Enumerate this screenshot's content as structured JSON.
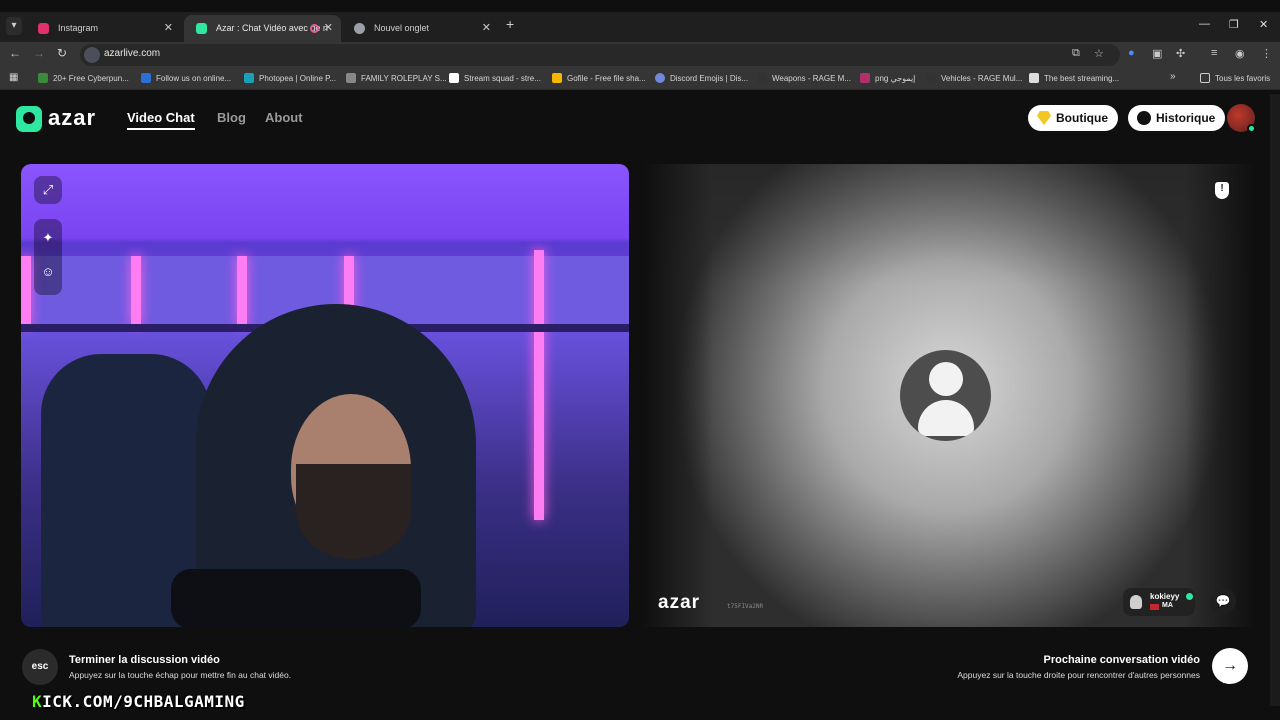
{
  "browser": {
    "tabs": [
      {
        "title": "Instagram",
        "icon": "instagram-icon",
        "color": "#e1306c",
        "active": false
      },
      {
        "title": "Azar : Chat Vidéo avec de n",
        "icon": "azar-icon",
        "color": "#2ee8a2",
        "active": true
      },
      {
        "title": "Nouvel onglet",
        "icon": "chrome-icon",
        "color": "#9aa0a6",
        "active": false
      }
    ],
    "url": "azarlive.com",
    "bookmarks": [
      {
        "label": "20+ Free Cyberpun...",
        "color": "#3d8a3a"
      },
      {
        "label": "Follow us on online...",
        "color": "#2a6fd6"
      },
      {
        "label": "Photopea | Online P...",
        "color": "#17a2b8"
      },
      {
        "label": "FAMILY ROLEPLAY S...",
        "color": "#888888"
      },
      {
        "label": "Stream squad - stre...",
        "color": "#ffffff"
      },
      {
        "label": "Gofile - Free file sha...",
        "color": "#f5b700"
      },
      {
        "label": "Discord Emojis | Dis...",
        "color": "#7289da"
      },
      {
        "label": "Weapons - RAGE M...",
        "color": "#333333"
      },
      {
        "label": "png إيموجي",
        "color": "#b0306a"
      },
      {
        "label": "Vehicles - RAGE Mul...",
        "color": "#333333"
      },
      {
        "label": "The best streaming...",
        "color": "#dddddd"
      }
    ],
    "all_bookmarks": "Tous les favoris"
  },
  "site": {
    "logo": "azar",
    "nav": [
      "Video Chat",
      "Blog",
      "About"
    ],
    "shop_label": "Boutique",
    "history_label": "Historique"
  },
  "partner": {
    "watermark": "azar",
    "watermark_id": "t75FIVa2NR",
    "username": "kokieyy",
    "country": "MA"
  },
  "footer": {
    "esc_label": "esc",
    "end_title": "Terminer la discussion vidéo",
    "end_sub": "Appuyez sur la touche échap pour mettre fin au chat vidéo.",
    "next_title": "Prochaine conversation vidéo",
    "next_sub": "Appuyez sur la touche droite pour rencontrer d'autres personnes"
  },
  "overlay": {
    "kick_prefix": "K",
    "kick_rest": "ICK.COM/9CHBALGAMING"
  }
}
